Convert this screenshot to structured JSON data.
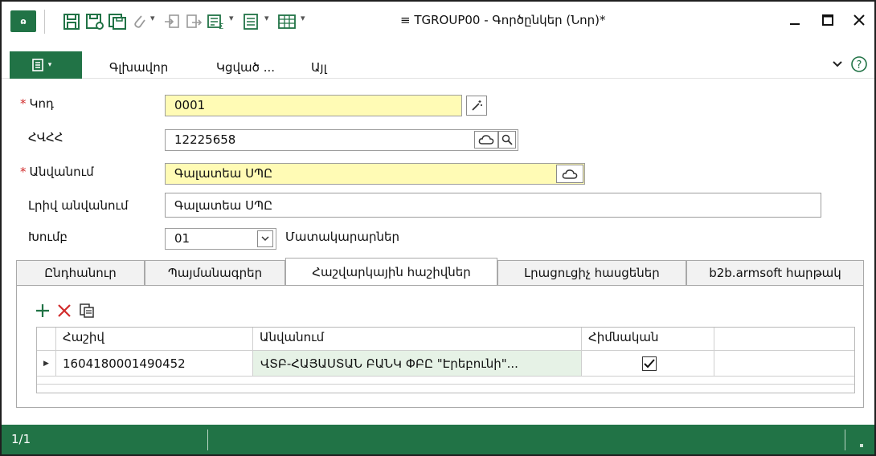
{
  "window": {
    "app_icon_text": "ɷ",
    "title": "≡ TGROUP00 - Գործընկեր (Նոր)*"
  },
  "ribbon": {
    "tabs": [
      "Գլխավոր",
      "Կցված ...",
      "Այլ"
    ]
  },
  "form": {
    "code": {
      "label": "Կոդ",
      "value": "0001"
    },
    "tin": {
      "label": "ՀՎՀՀ",
      "value": "12225658"
    },
    "name": {
      "label": "Անվանում",
      "value": "Գալատեա ՍՊԸ"
    },
    "full_name": {
      "label": "Լրիվ անվանում",
      "value": "Գալատեա ՍՊԸ"
    },
    "group": {
      "label": "Խումբ",
      "value": "01",
      "description": "Մատակարարներ"
    }
  },
  "tabs": [
    {
      "label": "Ընդհանուր",
      "active": false
    },
    {
      "label": "Պայմանագրեր",
      "active": false
    },
    {
      "label": "Հաշվարկային հաշիվներ",
      "active": true
    },
    {
      "label": "Լրացուցիչ հասցեներ",
      "active": false
    },
    {
      "label": "b2b.armsoft հարթակ",
      "active": false
    }
  ],
  "grid": {
    "headers": [
      "Հաշիվ",
      "Անվանում",
      "Հիմնական"
    ],
    "rows": [
      {
        "account": "1604180001490452",
        "name": "ՎՏԲ-ՀԱՅԱՍՏԱՆ ԲԱՆԿ ՓԲԸ \"Էրեբունի\"...",
        "primary": true
      }
    ]
  },
  "status": {
    "record_counter": "1/1"
  },
  "colors": {
    "accent_green": "#217346",
    "required_field_bg": "#fffbb5",
    "required_marker": "#d12c2c"
  },
  "icons": {
    "toolbar": [
      "save-icon",
      "save-as-icon",
      "save-copy-icon",
      "attach-icon",
      "import-icon",
      "export-icon",
      "summary-icon",
      "list-icon",
      "table-icon"
    ],
    "grid_toolbar": [
      "add-icon",
      "delete-icon",
      "copy-icon"
    ]
  }
}
